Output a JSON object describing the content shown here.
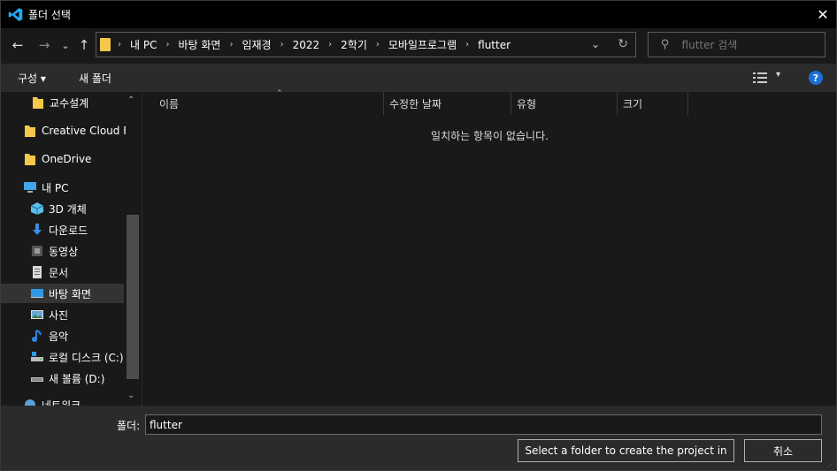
{
  "titlebar": {
    "title": "폴더 선택",
    "close": "✕"
  },
  "nav": {
    "back": "←",
    "forward": "→",
    "recent": "⌄",
    "up": "↑",
    "breadcrumbs": [
      "내 PC",
      "바탕 화면",
      "임재경",
      "2022",
      "2학기",
      "모바일프로그램",
      "flutter"
    ],
    "separator": "›",
    "dropdown": "⌄",
    "refresh": "↻",
    "search_placeholder": "flutter 검색"
  },
  "toolbar": {
    "organize": "구성 ▾",
    "new_folder": "새 폴더",
    "view_dropdown": "▾",
    "help": "?"
  },
  "sidebar": {
    "items": [
      {
        "label": "교수설계",
        "icon": "folder-icon",
        "color": "#f4c94b"
      },
      {
        "label": "Creative Cloud Fil",
        "icon": "folder-icon",
        "color": "#f4c94b"
      },
      {
        "label": "OneDrive",
        "icon": "folder-icon",
        "color": "#f4c94b"
      },
      {
        "label": "내 PC",
        "icon": "pc-icon",
        "color": "#3ea6e6"
      },
      {
        "label": "3D 개체",
        "icon": "3d-objects-icon",
        "color": "#5bc0eb"
      },
      {
        "label": "다운로드",
        "icon": "download-icon",
        "color": "#3b8fe0"
      },
      {
        "label": "동영상",
        "icon": "video-icon",
        "color": "#9a9a9a"
      },
      {
        "label": "문서",
        "icon": "document-icon",
        "color": "#d8d8d8"
      },
      {
        "label": "바탕 화면",
        "icon": "desktop-icon",
        "color": "#2e9ae6"
      },
      {
        "label": "사진",
        "icon": "pictures-icon",
        "color": "#6aa8d8"
      },
      {
        "label": "음악",
        "icon": "music-icon",
        "color": "#2f86e0"
      },
      {
        "label": "로컬 디스크 (C:)",
        "icon": "drive-c-icon",
        "color": "#bbbbbb"
      },
      {
        "label": "새 볼륨 (D:)",
        "icon": "drive-d-icon",
        "color": "#bbbbbb"
      },
      {
        "label": "네트워크",
        "icon": "network-icon",
        "color": "#5aa0d8"
      }
    ],
    "scroll_up": "⌃",
    "scroll_down": "⌄"
  },
  "columns": [
    "이름",
    "수정한 날짜",
    "유형",
    "크기"
  ],
  "sort_arrow": "⌃",
  "empty_message": "일치하는 항목이 없습니다.",
  "bottom": {
    "folder_label": "폴더:",
    "folder_value": "flutter",
    "select_button": "Select a folder to create the project in",
    "cancel_button": "취소"
  },
  "colors": {
    "accent": "#1a6fd8",
    "folder": "#f4c94b",
    "vscode": "#23a9f2"
  }
}
